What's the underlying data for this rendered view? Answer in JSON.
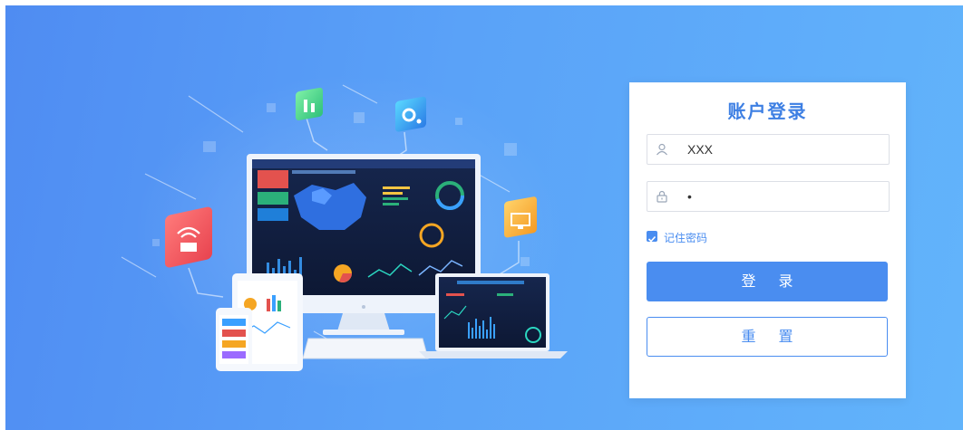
{
  "login": {
    "title": "账户登录",
    "username_value": "XXX",
    "password_value": "•",
    "remember_label": "记住密码",
    "remember_checked": true,
    "login_button": "登 录",
    "reset_button": "重 置"
  },
  "icons": {
    "username": "user-icon",
    "password": "lock-icon",
    "remember": "checkbox-checked-icon"
  },
  "colors": {
    "background_start": "#4f8cf2",
    "background_end": "#62b4fb",
    "accent": "#4a8df0",
    "title": "#3d7fe3"
  }
}
